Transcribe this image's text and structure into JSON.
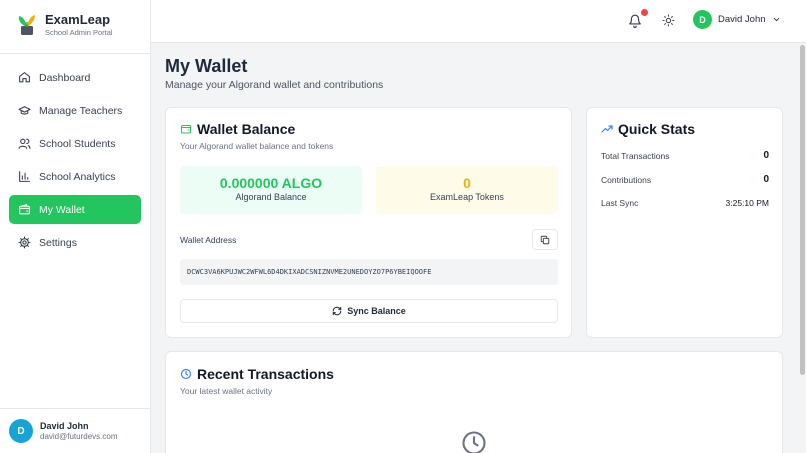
{
  "brand": {
    "title": "ExamLeap",
    "subtitle": "School Admin Portal"
  },
  "nav": [
    {
      "label": "Dashboard",
      "icon": "home-icon",
      "active": false
    },
    {
      "label": "Manage Teachers",
      "icon": "graduation-cap-icon",
      "active": false
    },
    {
      "label": "School Students",
      "icon": "users-icon",
      "active": false
    },
    {
      "label": "School Analytics",
      "icon": "bar-chart-icon",
      "active": false
    },
    {
      "label": "My Wallet",
      "icon": "wallet-icon",
      "active": true
    },
    {
      "label": "Settings",
      "icon": "gear-icon",
      "active": false
    }
  ],
  "sidebar_user": {
    "initial": "D",
    "name": "David John",
    "email": "david@futurdevs.com"
  },
  "header": {
    "user_initial": "D",
    "user_name": "David John"
  },
  "page": {
    "title": "My Wallet",
    "subtitle": "Manage your Algorand wallet and contributions"
  },
  "wallet": {
    "title": "Wallet Balance",
    "subtitle": "Your Algorand wallet balance and tokens",
    "algo_value": "0.000000 ALGO",
    "algo_label": "Algorand Balance",
    "token_value": "0",
    "token_label": "ExamLeap Tokens",
    "address_label": "Wallet Address",
    "address": "DCWC3VA6KPUJWC2WFWL6D4DKIXADCSNIZNVME2UNEDOYZO7P6YBEIQOOFE",
    "sync_label": "Sync Balance"
  },
  "stats": {
    "title": "Quick Stats",
    "rows": [
      {
        "label": "Total Transactions",
        "value": "0"
      },
      {
        "label": "Contributions",
        "value": "0"
      },
      {
        "label": "Last Sync",
        "value": "3:25:10 PM"
      }
    ]
  },
  "transactions": {
    "title": "Recent Transactions",
    "subtitle": "Your latest wallet activity"
  },
  "colors": {
    "accent": "#22c55e",
    "token": "#eab308",
    "avatar": "#16a3d6",
    "notification": "#ef4444"
  }
}
